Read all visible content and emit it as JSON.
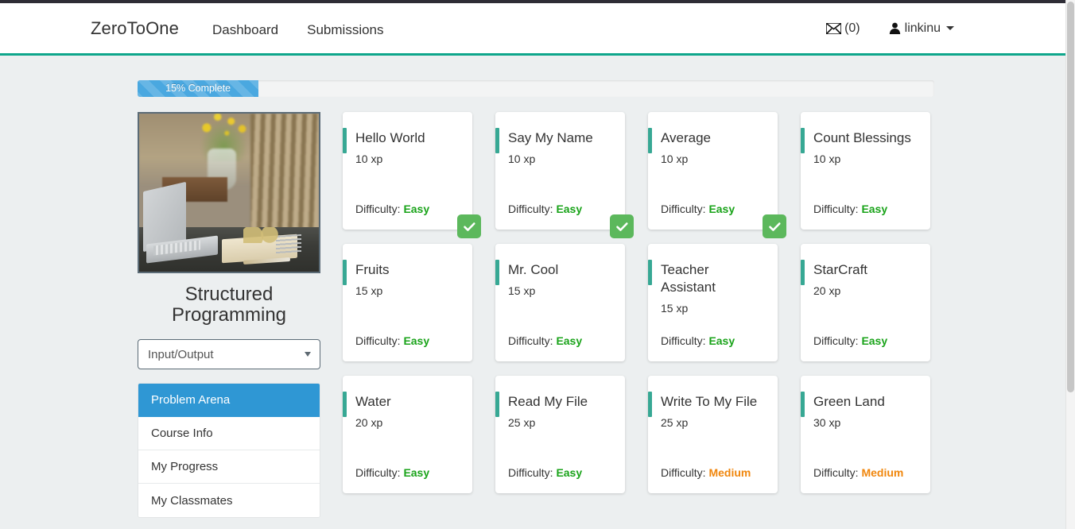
{
  "navbar": {
    "brand": "ZeroToOne",
    "links": [
      {
        "label": "Dashboard"
      },
      {
        "label": "Submissions"
      }
    ],
    "messages": {
      "icon": "envelope-icon",
      "label": "(0)"
    },
    "user": {
      "icon": "user-icon",
      "label": "linkinu",
      "caret": "caret-down-icon"
    },
    "accent_color": "#0ea68b"
  },
  "progress": {
    "label": "15% Complete",
    "percent": 15,
    "bar_color": "#4aa8e0",
    "track_color": "#f3f4f4"
  },
  "sidebar": {
    "course_image_alt": "laptop-notebook-desk-photo",
    "course_title": "Structured Programming",
    "topic_select": {
      "value": "Input/Output",
      "arrow_icon": "chevron-down-icon"
    },
    "nav_items": [
      {
        "label": "Problem Arena",
        "active": true
      },
      {
        "label": "Course Info",
        "active": false
      },
      {
        "label": "My Progress",
        "active": false
      },
      {
        "label": "My Classmates",
        "active": false
      }
    ],
    "active_color": "#2f97d4"
  },
  "problems": {
    "xp_suffix": "xp",
    "difficulty_prefix": "Difficulty:",
    "accent_color": "#37a894",
    "easy_color": "#19a319",
    "medium_color": "#f0860c",
    "solved_icon": "check-icon",
    "items": [
      {
        "title": "Hello World",
        "xp": "10 xp",
        "difficulty": "Easy",
        "solved": true
      },
      {
        "title": "Say My Name",
        "xp": "10 xp",
        "difficulty": "Easy",
        "solved": true
      },
      {
        "title": "Average",
        "xp": "10 xp",
        "difficulty": "Easy",
        "solved": true
      },
      {
        "title": "Count Blessings",
        "xp": "10 xp",
        "difficulty": "Easy",
        "solved": false
      },
      {
        "title": "Fruits",
        "xp": "15 xp",
        "difficulty": "Easy",
        "solved": false
      },
      {
        "title": "Mr. Cool",
        "xp": "15 xp",
        "difficulty": "Easy",
        "solved": false
      },
      {
        "title": "Teacher Assistant",
        "xp": "15 xp",
        "difficulty": "Easy",
        "solved": false
      },
      {
        "title": "StarCraft",
        "xp": "20 xp",
        "difficulty": "Easy",
        "solved": false
      },
      {
        "title": "Water",
        "xp": "20 xp",
        "difficulty": "Easy",
        "solved": false
      },
      {
        "title": "Read My File",
        "xp": "25 xp",
        "difficulty": "Easy",
        "solved": false
      },
      {
        "title": "Write To My File",
        "xp": "25 xp",
        "difficulty": "Medium",
        "solved": false
      },
      {
        "title": "Green Land",
        "xp": "30 xp",
        "difficulty": "Medium",
        "solved": false
      }
    ]
  }
}
